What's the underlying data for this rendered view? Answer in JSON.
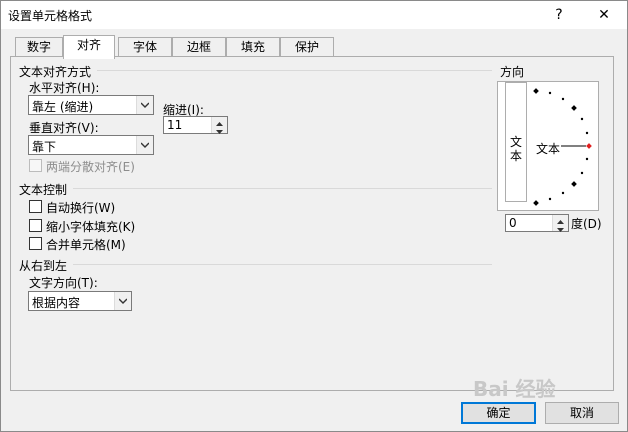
{
  "window": {
    "title": "设置单元格格式",
    "help_label": "?",
    "close_label": "✕"
  },
  "tabs": [
    {
      "label": "数字"
    },
    {
      "label": "对齐"
    },
    {
      "label": "字体"
    },
    {
      "label": "边框"
    },
    {
      "label": "填充"
    },
    {
      "label": "保护"
    }
  ],
  "alignment": {
    "group_title": "文本对齐方式",
    "horizontal_label": "水平对齐(H):",
    "horizontal_value": "靠左 (缩进)",
    "indent_label": "缩进(I):",
    "indent_value": "11",
    "vertical_label": "垂直对齐(V):",
    "vertical_value": "靠下",
    "distributed_label": "两端分散对齐(E)"
  },
  "text_control": {
    "group_title": "文本控制",
    "wrap_label": "自动换行(W)",
    "shrink_label": "缩小字体填充(K)",
    "merge_label": "合并单元格(M)"
  },
  "rtl": {
    "group_title": "从右到左",
    "direction_label": "文字方向(T):",
    "direction_value": "根据内容"
  },
  "orientation": {
    "group_title": "方向",
    "vertical_text": [
      "文",
      "本"
    ],
    "dial_text": "文本",
    "degrees_value": "0",
    "degrees_label": "度(D)"
  },
  "buttons": {
    "ok_label": "确定",
    "cancel_label": "取消"
  },
  "watermark": "Bai 经验"
}
